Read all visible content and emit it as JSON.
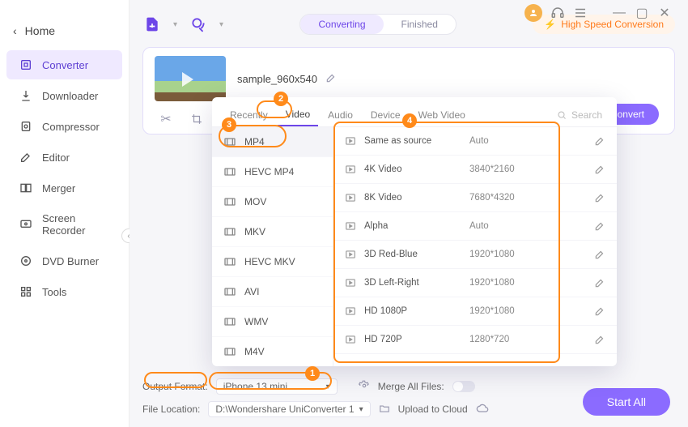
{
  "titlebar": {
    "min": "—",
    "max": "▢",
    "close": "✕"
  },
  "sidebar": {
    "home": "Home",
    "items": [
      {
        "label": "Converter",
        "active": true
      },
      {
        "label": "Downloader"
      },
      {
        "label": "Compressor"
      },
      {
        "label": "Editor"
      },
      {
        "label": "Merger"
      },
      {
        "label": "Screen Recorder"
      },
      {
        "label": "DVD Burner"
      },
      {
        "label": "Tools"
      }
    ]
  },
  "topbar": {
    "seg": {
      "a": "Converting",
      "b": "Finished"
    },
    "hsc": "High Speed Conversion"
  },
  "file": {
    "name": "sample_960x540",
    "convert": "Convert"
  },
  "pop": {
    "tabs": {
      "recent": "Recently",
      "video": "Video",
      "audio": "Audio",
      "device": "Device",
      "web": "Web Video"
    },
    "search": "Search",
    "formats": [
      "MP4",
      "HEVC MP4",
      "MOV",
      "MKV",
      "HEVC MKV",
      "AVI",
      "WMV",
      "M4V"
    ],
    "resolutions": [
      {
        "name": "Same as source",
        "dim": "Auto"
      },
      {
        "name": "4K Video",
        "dim": "3840*2160"
      },
      {
        "name": "8K Video",
        "dim": "7680*4320"
      },
      {
        "name": "Alpha",
        "dim": "Auto"
      },
      {
        "name": "3D Red-Blue",
        "dim": "1920*1080"
      },
      {
        "name": "3D Left-Right",
        "dim": "1920*1080"
      },
      {
        "name": "HD 1080P",
        "dim": "1920*1080"
      },
      {
        "name": "HD 720P",
        "dim": "1280*720"
      }
    ]
  },
  "footer": {
    "out_label": "Output Format:",
    "out_value": "iPhone 13 mini",
    "merge_label": "Merge All Files:",
    "loc_label": "File Location:",
    "loc_value": "D:\\Wondershare UniConverter 1",
    "upload_label": "Upload to Cloud",
    "start": "Start All"
  },
  "badges": {
    "b1": "1",
    "b2": "2",
    "b3": "3",
    "b4": "4"
  }
}
